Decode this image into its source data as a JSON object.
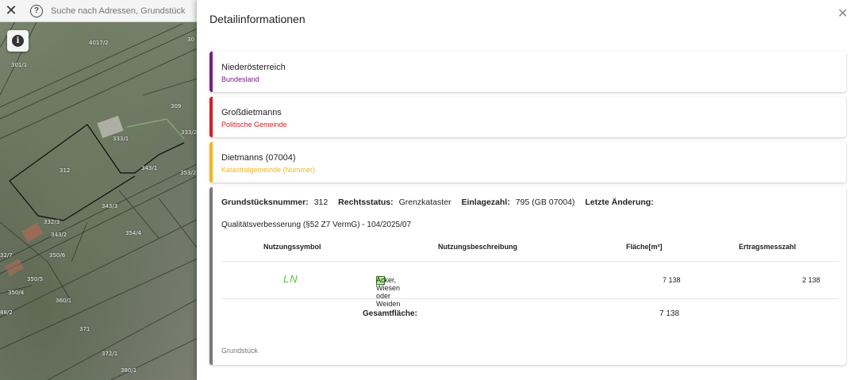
{
  "search": {
    "placeholder": "Suche nach Adressen, Grundstücken"
  },
  "map": {
    "parcels": [
      "4017/2",
      "301/1",
      "309",
      "333/2",
      "333/1",
      "312",
      "343/1",
      "353/2",
      "343/3",
      "332/3",
      "343/2",
      "354/4",
      "32/7",
      "350/6",
      "350/5",
      "350/4",
      "360/1",
      "88/2",
      "371",
      "372/1",
      "380/1",
      "30"
    ]
  },
  "panel": {
    "title": "Detailinformationen",
    "cards": {
      "bundesland": {
        "title": "Niederösterreich",
        "subtitle": "Bundesland"
      },
      "gemeinde": {
        "title": "Großdietmanns",
        "subtitle": "Politische Gemeinde"
      },
      "katastralgemeinde": {
        "title": "Dietmanns (07004)",
        "subtitle": "Katastralgemeinde (Nummer)"
      }
    },
    "grundstueck": {
      "nummer_label": "Grundstücksnummer:",
      "nummer": "312",
      "rechtsstatus_label": "Rechtsstatus:",
      "rechtsstatus": "Grenzkataster",
      "einlagezahl_label": "Einlagezahl:",
      "einlagezahl": "795 (GB 07004)",
      "aenderung_label": "Letzte Änderung:",
      "aenderung": "Qualitätsverbesserung (§52 Z7 VermG) - 104/2025/07",
      "table": {
        "headers": [
          "Nutzungssymbol",
          "Nutzungsbeschreibung",
          "Fläche[m²]",
          "Ertragsmesszahl"
        ],
        "rows": [
          {
            "symbol": "LN",
            "beschreibung": "Äcker, Wiesen oder Weiden",
            "flaeche": "7 138",
            "ertrag": "2 138"
          }
        ],
        "gesamt_label": "Gesamtfläche:",
        "gesamt_value": "7 138"
      },
      "footer": "Grundstück"
    }
  }
}
